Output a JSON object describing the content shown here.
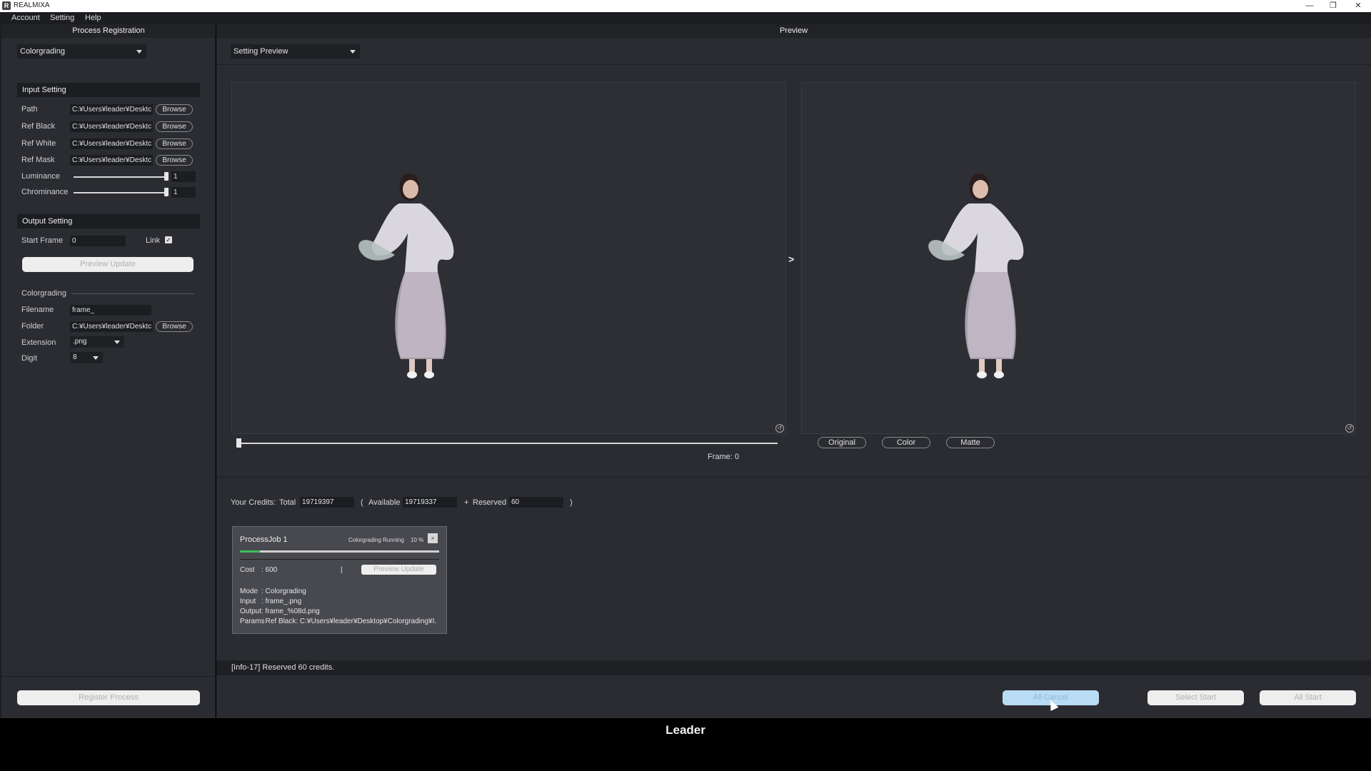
{
  "window": {
    "title": "REALMIXA",
    "icon_letter": "R",
    "minimize": "—",
    "restore": "❐",
    "close": "✕"
  },
  "menu": [
    "Account",
    "Setting",
    "Help"
  ],
  "left_panel": {
    "title": "Process Registration",
    "mode_select": "Colorgrading",
    "input_setting": {
      "heading": "Input Setting",
      "rows": [
        {
          "label": "Path",
          "value": "C:¥Users¥leader¥Desktc",
          "button": "Browse"
        },
        {
          "label": "Ref Black",
          "value": "C:¥Users¥leader¥Desktc",
          "button": "Browse"
        },
        {
          "label": "Ref White",
          "value": "C:¥Users¥leader¥Desktc",
          "button": "Browse"
        },
        {
          "label": "Ref Mask",
          "value": "C:¥Users¥leader¥Desktc",
          "button": "Browse"
        }
      ],
      "luminance": {
        "label": "Luminance",
        "value": "1",
        "level": 1.0
      },
      "chrominance": {
        "label": "Chrominance",
        "value": "1",
        "level": 1.0
      }
    },
    "output_setting": {
      "heading": "Output Setting",
      "start_frame_label": "Start Frame",
      "start_frame_value": "0",
      "link_label": "Link",
      "link_checked": true,
      "preview_update": "Preview Update"
    },
    "colorgrading": {
      "heading": "Colorgrading",
      "filename_label": "Filename",
      "filename_value": "frame_",
      "folder_label": "Folder",
      "folder_value": "C:¥Users¥leader¥Desktc",
      "folder_button": "Browse",
      "extension_label": "Extension",
      "extension_value": ".png",
      "digit_label": "Digit",
      "digit_value": "8"
    },
    "register_button": "Register Process"
  },
  "preview": {
    "title": "Preview",
    "setting_select": "Setting Preview",
    "arrow": ">",
    "frame_label": "Frame:",
    "frame_value": "0",
    "reset_icon": "↺",
    "view_buttons": [
      "Original",
      "Color",
      "Matte"
    ]
  },
  "credits": {
    "label": "Your Credits:",
    "total_label": "Total",
    "total_value": "19719397",
    "open_paren": "(",
    "available_label": "Available",
    "available_value": "19719337",
    "plus": "+",
    "reserved_label": "Reserved",
    "reserved_value": "60",
    "close_paren": ")"
  },
  "job": {
    "title": "ProcessJob 1",
    "status": "Colorgrading Running",
    "percent": "10 %",
    "progress": 0.1,
    "close": "×",
    "cost_label": "Cost",
    "cost_value": ": 600",
    "cost_sep": "|",
    "preview_update": "Preview Update",
    "details": [
      {
        "key": "Mode",
        "value": ": Colorgrading"
      },
      {
        "key": "Input",
        "value": ": frame_.png"
      },
      {
        "key": "Output",
        "value": ": frame_%08d.png"
      },
      {
        "key": "Params",
        "value": ": Ref Black: C:¥Users¥leader¥Desktop¥Colorgrading¥I."
      }
    ]
  },
  "info_message": "[Info-17] Reserved 60 credits.",
  "actions": {
    "all_cancel": "All Cancel",
    "select_start": "Select Start",
    "all_start": "All Start"
  },
  "brand": "Leader"
}
